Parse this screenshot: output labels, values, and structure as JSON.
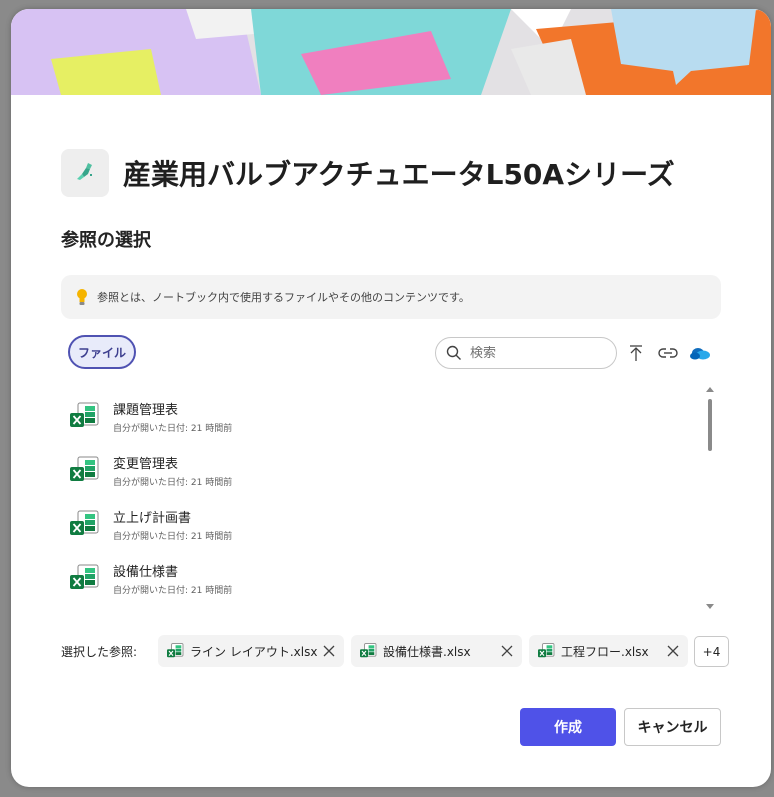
{
  "dialog": {
    "title": "産業用バルブアクチュエータL50Aシリーズ",
    "section_title": "参照の選択",
    "info_text": "参照とは、ノートブック内で使用するファイルやその他のコンテンツです。"
  },
  "tabs": {
    "files_label": "ファイル"
  },
  "search": {
    "placeholder": "検索"
  },
  "files": [
    {
      "name": "課題管理表",
      "meta": "自分が開いた日付: 21 時間前"
    },
    {
      "name": "変更管理表",
      "meta": "自分が開いた日付: 21 時間前"
    },
    {
      "name": "立上げ計画書",
      "meta": "自分が開いた日付: 21 時間前"
    },
    {
      "name": "設備仕様書",
      "meta": "自分が開いた日付: 21 時間前"
    }
  ],
  "selected": {
    "label": "選択した参照:",
    "chips": [
      {
        "name": "ライン レイアウト.xlsx"
      },
      {
        "name": "設備仕様書.xlsx"
      },
      {
        "name": "工程フロー.xlsx"
      }
    ],
    "more": "+4"
  },
  "actions": {
    "create": "作成",
    "cancel": "キャンセル"
  },
  "colors": {
    "accent": "#4f52e8",
    "excel": "#107c41",
    "chip_bg": "#f3f3f3"
  },
  "icons": [
    "notebook-icon",
    "lightbulb-icon",
    "search-icon",
    "upload-icon",
    "link-icon",
    "onedrive-icon",
    "excel-file-icon",
    "close-icon"
  ]
}
